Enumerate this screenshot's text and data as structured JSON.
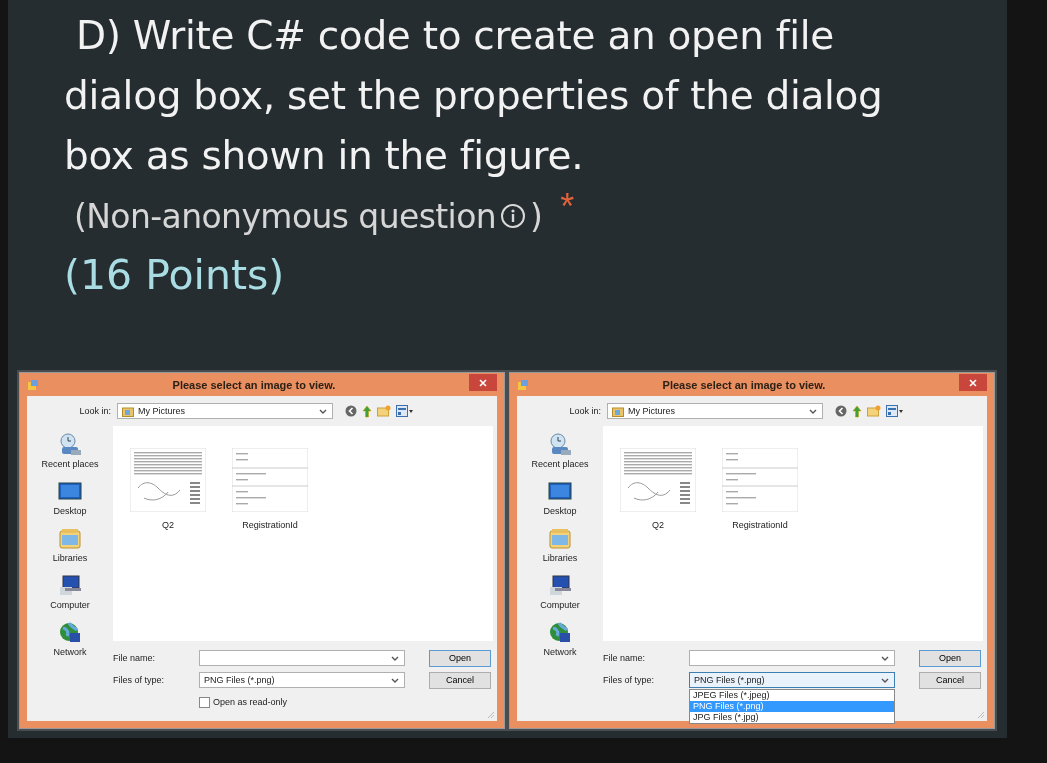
{
  "question": {
    "title": "D) Write C# code to create an open file dialog box, set the properties of the dialog box as shown in the figure.",
    "note": "(Non-anonymous question",
    "note_end": ")",
    "required_mark": "*",
    "points": "(16 Points)"
  },
  "dialogs": [
    {
      "title": "Please select an image to view.",
      "look_in_label": "Look in:",
      "look_in_value": "My Pictures",
      "places": [
        {
          "kind": "recent",
          "label": "Recent places"
        },
        {
          "kind": "desktop",
          "label": "Desktop"
        },
        {
          "kind": "libraries",
          "label": "Libraries"
        },
        {
          "kind": "computer",
          "label": "Computer"
        },
        {
          "kind": "network",
          "label": "Network"
        }
      ],
      "files": [
        {
          "kind": "table",
          "name": "Q2"
        },
        {
          "kind": "form",
          "name": "RegistrationId"
        }
      ],
      "file_name_label": "File name:",
      "file_type_label": "Files of type:",
      "file_type_value": "PNG Files (*.png)",
      "type_list_open": false,
      "read_only": {
        "label": "Open as read-only",
        "checked": false
      },
      "buttons": [
        "Open",
        "Cancel"
      ]
    },
    {
      "title": "Please select an image to view.",
      "look_in_label": "Look in:",
      "look_in_value": "My Pictures",
      "places": [
        {
          "kind": "recent",
          "label": "Recent places"
        },
        {
          "kind": "desktop",
          "label": "Desktop"
        },
        {
          "kind": "libraries",
          "label": "Libraries"
        },
        {
          "kind": "computer",
          "label": "Computer"
        },
        {
          "kind": "network",
          "label": "Network"
        }
      ],
      "files": [
        {
          "kind": "table",
          "name": "Q2"
        },
        {
          "kind": "form",
          "name": "RegistrationId"
        }
      ],
      "file_name_label": "File name:",
      "file_type_label": "Files of type:",
      "file_type_value": "PNG Files (*.png)",
      "type_list_open": true,
      "type_options": [
        {
          "label": "JPEG Files (*.jpeg)",
          "selected": false
        },
        {
          "label": "PNG Files (*.png)",
          "selected": true
        },
        {
          "label": "JPG Files (*.jpg)",
          "selected": false
        }
      ],
      "buttons": [
        "Open",
        "Cancel"
      ]
    }
  ]
}
